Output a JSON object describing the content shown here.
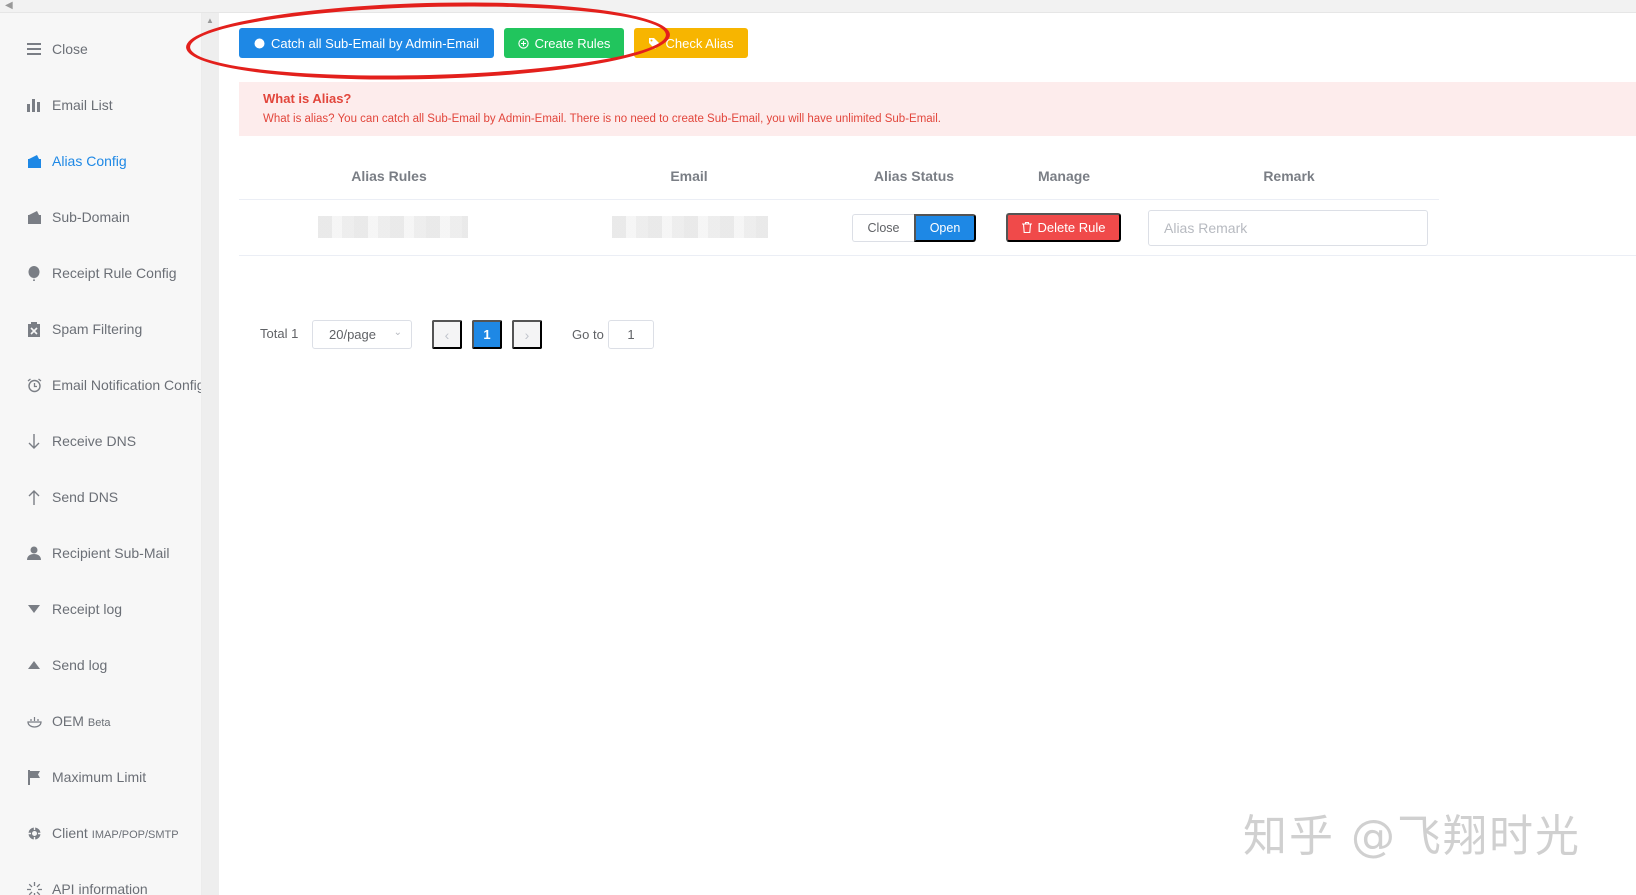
{
  "sidebar": {
    "items": [
      {
        "label": "Close",
        "icon": "menu-icon"
      },
      {
        "label": "Email List",
        "icon": "bar-chart-icon"
      },
      {
        "label": "Alias Config",
        "icon": "wallet-icon",
        "active": true
      },
      {
        "label": "Sub-Domain",
        "icon": "wallet-icon"
      },
      {
        "label": "Receipt Rule Config",
        "icon": "balloon-icon"
      },
      {
        "label": "Spam Filtering",
        "icon": "clipboard-x-icon"
      },
      {
        "label": "Email Notification Config",
        "icon": "alarm-clock-icon"
      },
      {
        "label": "Receive DNS",
        "icon": "arrow-down-icon"
      },
      {
        "label": "Send DNS",
        "icon": "arrow-up-icon"
      },
      {
        "label": "Recipient Sub-Mail",
        "icon": "user-icon"
      },
      {
        "label": "Receipt log",
        "icon": "triangle-down-icon"
      },
      {
        "label": "Send log",
        "icon": "triangle-up-icon"
      },
      {
        "label": "OEM",
        "sub": "Beta",
        "icon": "dish-icon"
      },
      {
        "label": "Maximum Limit",
        "icon": "flag-icon"
      },
      {
        "label": "Client",
        "sub": "IMAP/POP/SMTP",
        "icon": "lifebuoy-icon"
      },
      {
        "label": "API information",
        "icon": "loading-icon"
      }
    ]
  },
  "toolbar": {
    "catch_all_label": "Catch all Sub-Email by Admin-Email",
    "create_rules_label": "Create Rules",
    "check_alias_label": "Check Alias"
  },
  "alert": {
    "title": "What is Alias?",
    "description": "What is alias? You can catch all Sub-Email by Admin-Email. There is no need to create Sub-Email, you will have unlimited Sub-Email."
  },
  "table": {
    "columns": [
      "Alias Rules",
      "Email",
      "Alias Status",
      "Manage",
      "Remark"
    ],
    "rows": [
      {
        "status_close": "Close",
        "status_open": "Open",
        "status_selected": "Open",
        "delete_label": "Delete Rule",
        "remark_placeholder": "Alias Remark"
      }
    ]
  },
  "pagination": {
    "total": "Total 1",
    "page_size": "20/page",
    "current_page": "1",
    "goto_label": "Go to",
    "goto_value": "1"
  },
  "watermark": "知乎 @飞翔时光",
  "colors": {
    "primary": "#1e88e5",
    "success": "#21c55d",
    "warning": "#f7b500",
    "danger": "#f04a4a",
    "annotation": "#e3201c"
  }
}
